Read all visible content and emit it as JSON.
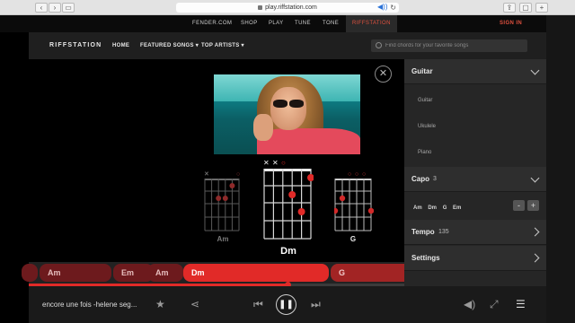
{
  "browser": {
    "url": "play.riffstation.com",
    "lock_icon": "lock-icon",
    "reload_icon": "reload-icon"
  },
  "fender_nav": {
    "items": [
      "FENDER.COM",
      "SHOP",
      "PLAY",
      "TUNE",
      "TONE",
      "RIFFSTATION"
    ],
    "active": "RIFFSTATION",
    "signin": "SIGN IN",
    "accent_color": "#e0513f"
  },
  "header": {
    "logo": "RIFFSTATION",
    "links": [
      "HOME",
      "FEATURED SONGS ▾",
      "TOP ARTISTS ▾"
    ],
    "search_placeholder": "Find chords for your favorite songs"
  },
  "chords": [
    {
      "name": "Am",
      "markers": "x  o",
      "highlight": false
    },
    {
      "name": "Dm",
      "markers": "xxo",
      "highlight": true
    },
    {
      "name": "G",
      "markers": "ooo",
      "highlight": false
    }
  ],
  "timeline": {
    "blocks": [
      "Am",
      "Em",
      "Am",
      "Dm"
    ],
    "active": "Dm",
    "next": "G",
    "accent_color": "#e12a28",
    "progress": 0.5
  },
  "player": {
    "song_title": "encore une fois -helene seg...",
    "icons": [
      "star-icon",
      "share-icon",
      "previous-icon",
      "pause-icon",
      "next-icon",
      "volume-icon",
      "fullscreen-icon",
      "mixer-icon"
    ]
  },
  "panel": {
    "instrument_label": "Guitar",
    "instrument_options": [
      "Guitar",
      "Ukulele",
      "Piano"
    ],
    "capo_label": "Capo",
    "capo_value": "3",
    "capo_chords": [
      "Am",
      "Dm",
      "G",
      "Em"
    ],
    "minus_label": "-",
    "plus_label": "+",
    "tempo_label": "Tempo",
    "tempo_value": "135",
    "settings_label": "Settings"
  }
}
